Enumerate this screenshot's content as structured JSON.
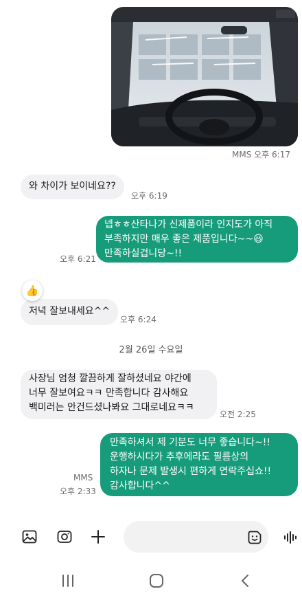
{
  "attachment": {
    "label": "MMS 오후 6:17"
  },
  "messages": [
    {
      "text": "와 차이가 보이네요??",
      "time": "오후 6:19"
    },
    {
      "text": "넵ㅎㅎ산타나가 신제품이라 인지도가 아직\n부족하지만 매우 좋은 제품입니다~~😃\n만족하실겁니당~!!",
      "time": "오후 6:21"
    },
    {
      "reaction": "👍",
      "text": "저녁 잘보내세요^^",
      "time": "오후 6:24"
    },
    {
      "text": "사장님 엄청 깔끔하게 잘하셨네요 야간에\n너무 잘보여요ㅋㅋ 만족합니다 감사해요\n백미러는 안건드셨나봐요 그대로네요ㅋㅋ",
      "time": "오전 2:25"
    },
    {
      "text": "만족하셔서 제 기분도 너무 좋습니다~!!\n운행하시다가 추후에라도 필름상의\n하자나 문제 발생시 편하게 연락주십쇼!!\n감사합니다^^",
      "type": "MMS",
      "time": "오후 2:33"
    }
  ],
  "date_separator": "2월 26일 수요일",
  "input": {
    "placeholder": "",
    "value": ""
  },
  "icons": {
    "gallery": "gallery-icon",
    "camera": "camera-icon",
    "plus": "plus-icon",
    "emoji": "emoji-icon",
    "voice": "voice-icon",
    "nav_recent": "recent-apps-icon",
    "nav_home": "home-icon",
    "nav_back": "back-icon"
  },
  "colors": {
    "outgoing_bubble": "#179c7b",
    "incoming_bubble": "#f1f1f3"
  }
}
